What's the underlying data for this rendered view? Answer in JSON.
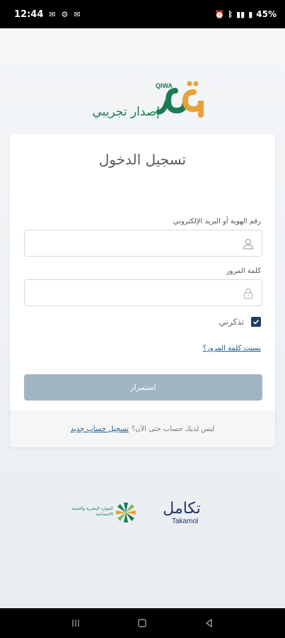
{
  "status_bar": {
    "time": "12:44",
    "battery": "45%"
  },
  "logo": {
    "brand_latin": "QIWA",
    "subtitle": "إصدار تجريبي"
  },
  "login": {
    "title": "تسجيل الدخول",
    "id_label": "رقم الهوية أو البريد الإلكتروني",
    "id_value": "",
    "password_label": "كلمة المرور",
    "password_value": "",
    "remember_label": "تذكرني",
    "remember_checked": true,
    "forgot_link": "نسيت كلمة المرور؟",
    "continue_label": "استمرار"
  },
  "footer": {
    "no_account_text": "ليس لديك حساب حتى الآن؟",
    "register_link": "تسجيل حساب جديد"
  },
  "partners": {
    "takamol_ar": "تكامل",
    "takamol_en": "Takamol",
    "hrsd_text": "الموارد البشرية والتنمية الاجتماعية"
  },
  "colors": {
    "brand_green": "#1b7d53",
    "brand_orange": "#e8a13a",
    "brand_navy": "#1d3b63",
    "button_disabled": "#9fb5c3",
    "link": "#1d5b8a"
  }
}
